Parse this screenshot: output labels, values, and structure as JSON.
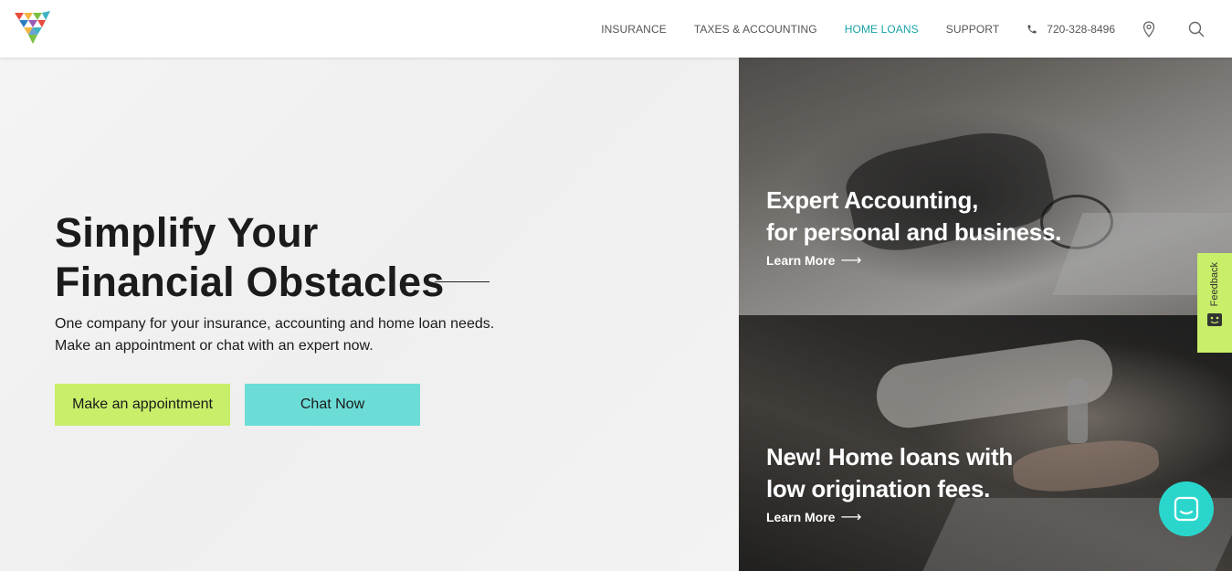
{
  "nav": {
    "items": [
      {
        "label": "INSURANCE",
        "active": false
      },
      {
        "label": "TAXES & ACCOUNTING",
        "active": false
      },
      {
        "label": "HOME LOANS",
        "active": true
      },
      {
        "label": "SUPPORT",
        "active": false
      }
    ],
    "phone": "720-328-8496",
    "icons": [
      "phone-icon",
      "location-pin-icon",
      "search-icon"
    ]
  },
  "hero": {
    "title_line1": "Simplify Your",
    "title_line2": "Financial Obstacles",
    "subtitle_line1": "One company for your insurance, accounting and home loan needs.",
    "subtitle_line2": "Make an appointment or chat with an expert now.",
    "appointment_label": "Make an appointment",
    "chat_label": "Chat Now"
  },
  "panels": {
    "top": {
      "title_line1": "Expert Accounting,",
      "title_line2": "for personal and business.",
      "link": "Learn More"
    },
    "bottom": {
      "title_line1": "New! Home loans with",
      "title_line2": "low origination fees.",
      "link": "Learn More"
    }
  },
  "feedback": {
    "label": "Feedback"
  },
  "colors": {
    "accent_teal": "#1aa3a8",
    "button_green": "#c8ee6a",
    "button_teal": "#6cdcd6",
    "chat_bubble": "#2ad6cc"
  }
}
